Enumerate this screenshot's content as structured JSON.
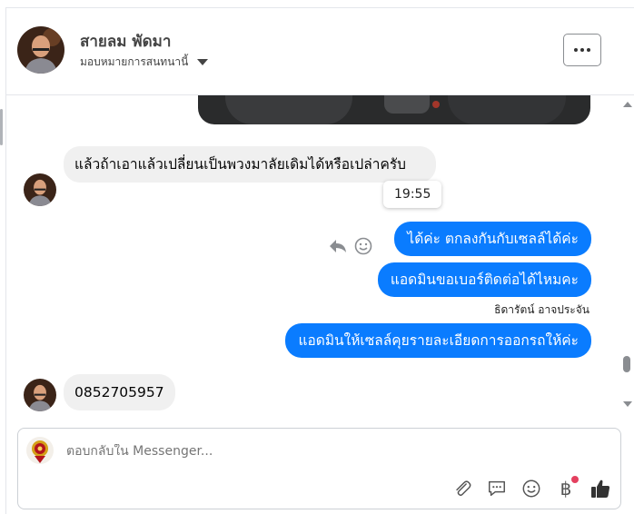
{
  "header": {
    "name": "สายลม พัดมา",
    "assign_label": "มอบหมายการสนทนานี้"
  },
  "messages": {
    "incoming_1": "แล้วถ้าเอาแล้วเปลี่ยนเป็นพวงมาลัยเดิมได้หรือเปล่าครับ",
    "tooltip_time": "19:55",
    "outgoing_1": "ได้ค่ะ ตกลงกันกับเซลล์ได้ค่ะ",
    "outgoing_2": "แอดมินขอเบอร์ติดต่อได้ไหมคะ",
    "sender_name": "ธิดารัตน์ อาจประจัน",
    "outgoing_3": "แอดมินให้เซลล์คุยรายละเอียดการออกรถให้ค่ะ",
    "incoming_2": "0852705957"
  },
  "composer": {
    "placeholder": "ตอบกลับใน Messenger..."
  },
  "icons": [
    "more-icon",
    "reply-icon",
    "emoji-react-icon",
    "attachment-icon",
    "saved-replies-icon",
    "emoji-icon",
    "payment-icon",
    "like-icon"
  ],
  "colors": {
    "accent": "#0a7cff",
    "incoming_bubble": "#f0f0f0",
    "notification_dot": "#e4405f"
  }
}
